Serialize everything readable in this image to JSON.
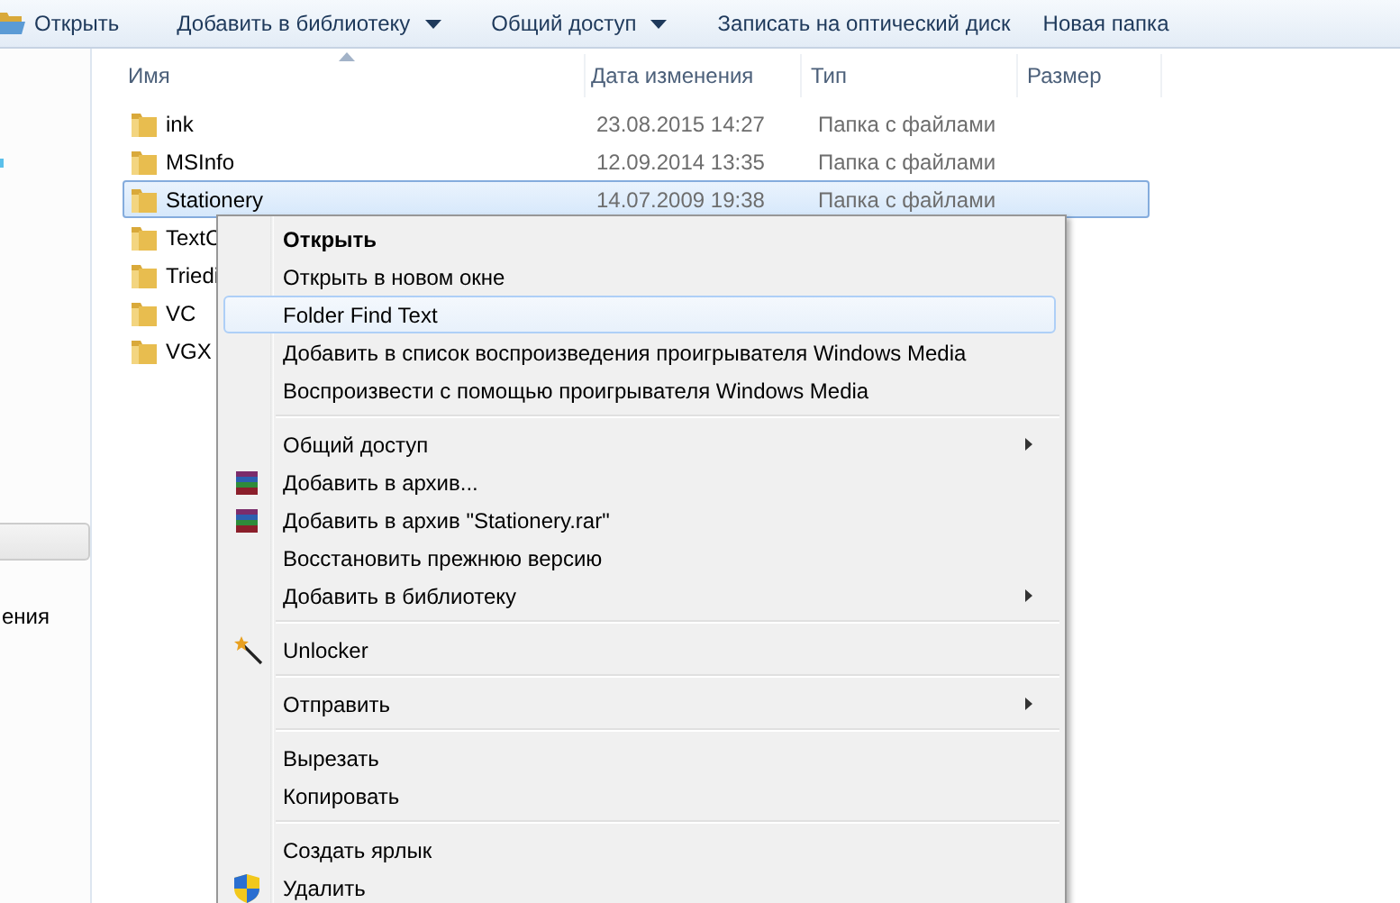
{
  "toolbar": [
    {
      "label": "Открыть",
      "kind": "open"
    },
    {
      "label": "Добавить в библиотеку",
      "kind": "dropdown"
    },
    {
      "label": "Общий доступ",
      "kind": "dropdown"
    },
    {
      "label": "Записать на оптический диск",
      "kind": "plain"
    },
    {
      "label": "Новая папка",
      "kind": "plain"
    }
  ],
  "sidebar": {
    "items": [
      {
        "label": "ения"
      }
    ]
  },
  "table": {
    "columns": [
      {
        "label": "Имя",
        "sorted": true
      },
      {
        "label": "Дата изменения",
        "sorted": false
      },
      {
        "label": "Тип",
        "sorted": false
      },
      {
        "label": "Размер",
        "sorted": false
      }
    ],
    "rows": [
      {
        "name": "ink",
        "date": "23.08.2015 14:27",
        "type": "Папка с файлами",
        "selected": false
      },
      {
        "name": "MSInfo",
        "date": "12.09.2014 13:35",
        "type": "Папка с файлами",
        "selected": false
      },
      {
        "name": "Stationery",
        "date": "14.07.2009 19:38",
        "type": "Папка с файлами",
        "selected": true
      },
      {
        "name": "TextC",
        "selected": false
      },
      {
        "name": "Triedi",
        "selected": false
      },
      {
        "name": "VC",
        "selected": false
      },
      {
        "name": "VGX",
        "selected": false
      }
    ]
  },
  "context_menu": {
    "items": [
      {
        "kind": "item",
        "label": "Открыть",
        "default": true,
        "submenu": false,
        "selected": false
      },
      {
        "kind": "item",
        "label": "Открыть в новом окне",
        "default": false,
        "submenu": false,
        "selected": false
      },
      {
        "kind": "item",
        "label": "Folder Find Text",
        "default": false,
        "submenu": false,
        "selected": true
      },
      {
        "kind": "item",
        "label": "Добавить в список воспроизведения проигрывателя Windows Media",
        "default": false,
        "submenu": false,
        "selected": false
      },
      {
        "kind": "item",
        "label": "Воспроизвести с помощью проигрывателя Windows Media",
        "default": false,
        "submenu": false,
        "selected": false
      },
      {
        "kind": "separator"
      },
      {
        "kind": "item",
        "label": "Общий доступ",
        "default": false,
        "submenu": true,
        "selected": false
      },
      {
        "kind": "rar",
        "label": "Добавить в архив...",
        "default": false,
        "submenu": false,
        "selected": false
      },
      {
        "kind": "rar",
        "label": "Добавить в архив \"Stationery.rar\"",
        "default": false,
        "submenu": false,
        "selected": false
      },
      {
        "kind": "item",
        "label": "Восстановить прежнюю версию",
        "default": false,
        "submenu": false,
        "selected": false
      },
      {
        "kind": "item",
        "label": "Добавить в библиотеку",
        "default": false,
        "submenu": true,
        "selected": false
      },
      {
        "kind": "separator"
      },
      {
        "kind": "wand",
        "label": "Unlocker",
        "default": false,
        "submenu": false,
        "selected": false
      },
      {
        "kind": "separator"
      },
      {
        "kind": "item",
        "label": "Отправить",
        "default": false,
        "submenu": true,
        "selected": false
      },
      {
        "kind": "separator"
      },
      {
        "kind": "item",
        "label": "Вырезать",
        "default": false,
        "submenu": false,
        "selected": false
      },
      {
        "kind": "item",
        "label": "Копировать",
        "default": false,
        "submenu": false,
        "selected": false
      },
      {
        "kind": "separator"
      },
      {
        "kind": "item",
        "label": "Создать ярлык",
        "default": false,
        "submenu": false,
        "selected": false
      },
      {
        "kind": "shield",
        "label": "Удалить",
        "default": false,
        "submenu": false,
        "selected": false
      }
    ]
  }
}
